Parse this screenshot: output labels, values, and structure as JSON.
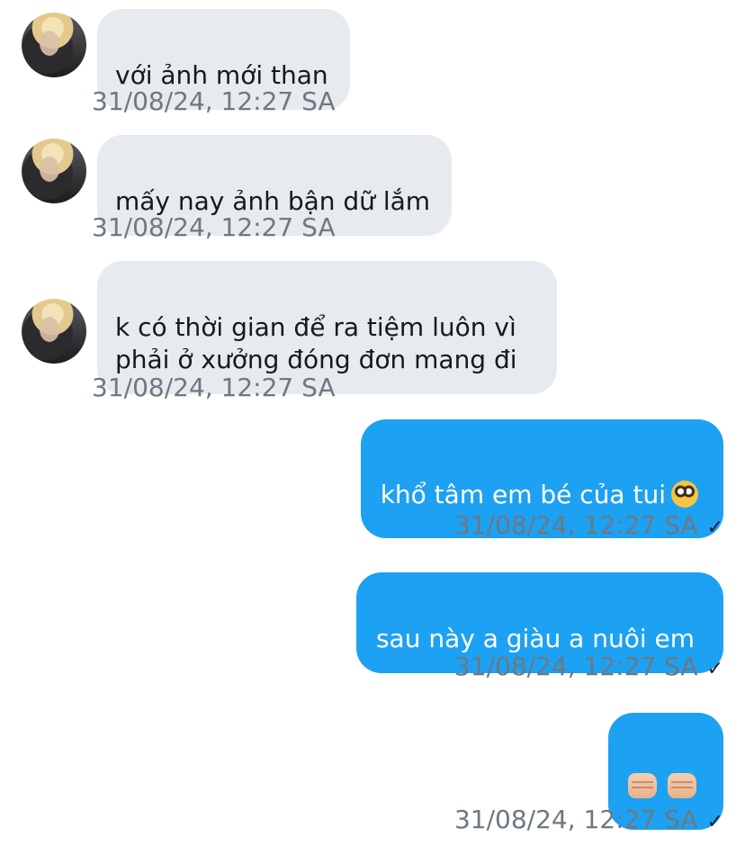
{
  "messages": [
    {
      "direction": "in",
      "text": "với ảnh mới than",
      "time": "31/08/24, 12:27 SA"
    },
    {
      "direction": "in",
      "text": "mấy nay ảnh bận dữ lắm",
      "time": "31/08/24, 12:27 SA"
    },
    {
      "direction": "in",
      "text": "k có thời gian để ra tiệm luôn vì\nphải ở xưởng đóng đơn mang đi",
      "time": "31/08/24, 12:27 SA"
    },
    {
      "direction": "out",
      "text": "khổ tâm em bé của tui",
      "emoji": "pleading-face",
      "time": "31/08/24, 12:27 SA",
      "status": "✓"
    },
    {
      "direction": "out",
      "text": "sau này a giàu a nuôi em",
      "time": "31/08/24, 12:27 SA",
      "status": "✓"
    },
    {
      "direction": "out",
      "text": "",
      "emoji": "fist-fist",
      "time": "31/08/24, 12:27 SA",
      "status": "✓"
    }
  ]
}
